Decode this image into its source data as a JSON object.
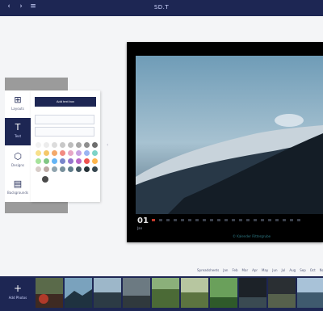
{
  "topbar": {
    "title": "SD.T"
  },
  "tools": [
    {
      "label": "Layouts",
      "icon": "layouts-icon"
    },
    {
      "label": "Text",
      "icon": "text-icon"
    },
    {
      "label": "Designs",
      "icon": "designs-icon"
    },
    {
      "label": "Backgrounds",
      "icon": "backgrounds-icon"
    }
  ],
  "editor": {
    "add_label": "Add text box"
  },
  "calendar": {
    "month_number": "01",
    "month_name": "Jan",
    "credit": "© Kalender Rittergrube"
  },
  "bottom": {
    "add_photos_label": "Add Photos"
  },
  "months_row": [
    "Spreadsheets",
    "Jan",
    "Feb",
    "Mar",
    "Apr",
    "May",
    "Jun",
    "Jul",
    "Aug",
    "Sep",
    "Oct",
    "Nov"
  ],
  "colors": {
    "primary": "#1d2653",
    "swatches": [
      "#f2f2f2",
      "#ececec",
      "#dcdcdc",
      "#c8c8c8",
      "#bdbdbd",
      "#a9a9a9",
      "#8e8e8e",
      "#6d6d6d",
      "#f8e08a",
      "#f5c869",
      "#f3a96b",
      "#f28b82",
      "#e7a7c6",
      "#c7a3e3",
      "#9bb5f3",
      "#7dd3c7",
      "#a6e39b",
      "#81c784",
      "#64b5f6",
      "#7986cb",
      "#9575cd",
      "#ba68c8",
      "#ef5350",
      "#ffb74d",
      "#d7ccc8",
      "#bcaaa4",
      "#90a4ae",
      "#78909c",
      "#607d8b",
      "#455a64",
      "#263238",
      "#37474f"
    ]
  }
}
